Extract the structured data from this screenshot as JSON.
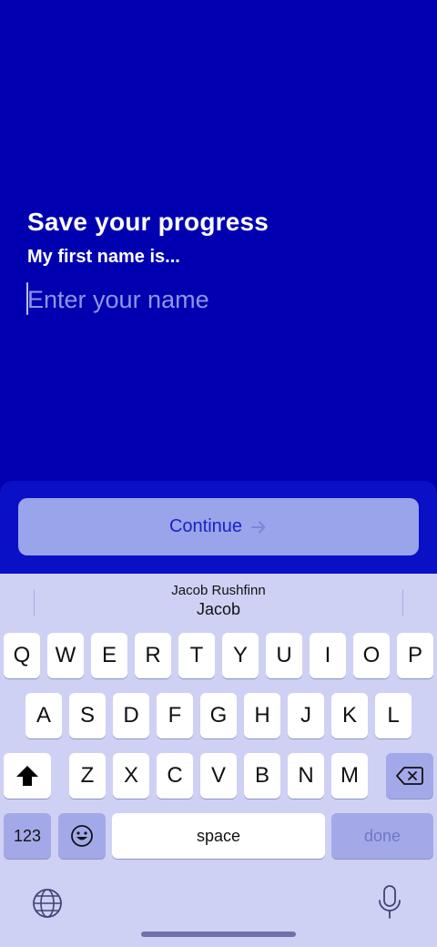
{
  "header": {
    "title": "Save your progress",
    "subtitle": "My first name is..."
  },
  "name_input": {
    "value": "",
    "placeholder": "Enter your name"
  },
  "continue_button": {
    "label": "Continue",
    "icon": "arrow-right-icon"
  },
  "keyboard": {
    "suggestion": {
      "line1": "Jacob Rushfinn",
      "line2": "Jacob"
    },
    "row1": [
      "Q",
      "W",
      "E",
      "R",
      "T",
      "Y",
      "U",
      "I",
      "O",
      "P"
    ],
    "row2": [
      "A",
      "S",
      "D",
      "F",
      "G",
      "H",
      "J",
      "K",
      "L"
    ],
    "row3": [
      "Z",
      "X",
      "C",
      "V",
      "B",
      "N",
      "M"
    ],
    "numbers_label": "123",
    "space_label": "space",
    "done_label": "done",
    "icons": [
      "shift-icon",
      "backspace-icon",
      "emoji-icon",
      "globe-icon",
      "microphone-icon"
    ]
  },
  "colors": {
    "background": "#0000B0",
    "button": "#9AA4EA",
    "keyboard": "#CED1F3"
  }
}
